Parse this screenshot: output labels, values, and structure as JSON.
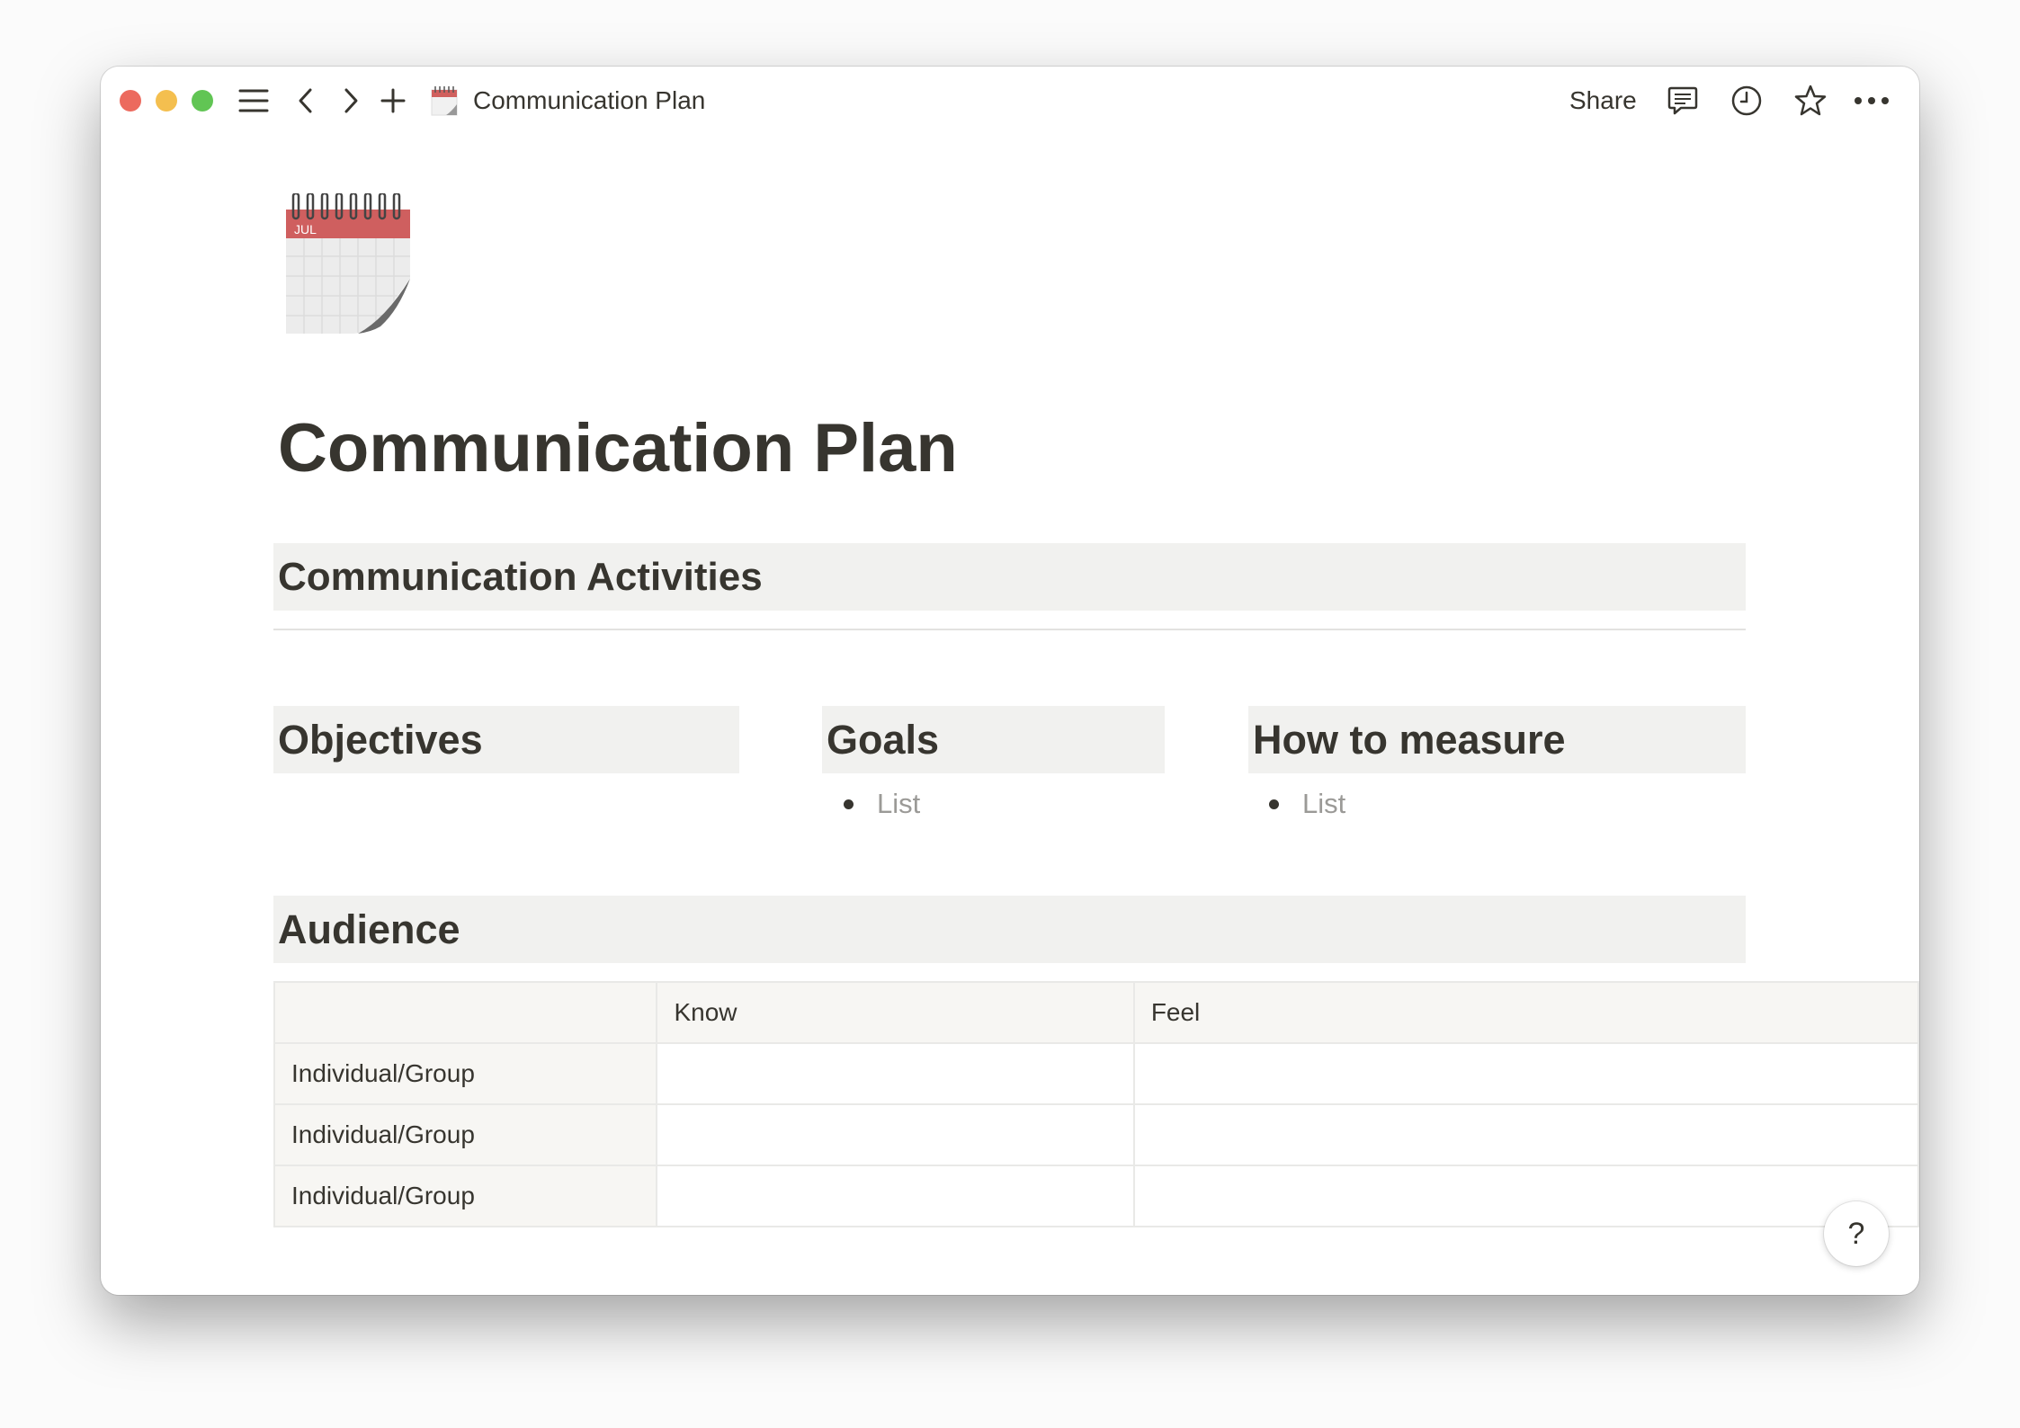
{
  "window": {
    "traffic_lights": {
      "close": "#ec6a5e",
      "minimize": "#f4bf4f",
      "zoom": "#61c554"
    },
    "toolbar": {
      "menu_icon": "hamburger-icon",
      "back_icon": "chevron-left-icon",
      "forward_icon": "chevron-right-icon",
      "new_icon": "plus-icon",
      "page_icon": "spiral-calendar-icon",
      "title": "Communication Plan",
      "share_label": "Share",
      "comments_icon": "comment-icon",
      "history_icon": "clock-icon",
      "favorite_icon": "star-icon",
      "more_icon": "more-dots-icon"
    }
  },
  "page": {
    "icon": "spiral-calendar-icon",
    "icon_month": "JUL",
    "title": "Communication Plan",
    "section_activities": "Communication Activities",
    "columns": [
      {
        "heading": "Objectives",
        "items": []
      },
      {
        "heading": "Goals",
        "items": [
          "List"
        ]
      },
      {
        "heading": "How to measure",
        "items": [
          "List"
        ]
      }
    ],
    "section_audience": "Audience",
    "table": {
      "headers": [
        "",
        "Know",
        "Feel"
      ],
      "rows": [
        [
          "Individual/Group",
          "",
          ""
        ],
        [
          "Individual/Group",
          "",
          ""
        ],
        [
          "Individual/Group",
          "",
          ""
        ]
      ]
    }
  },
  "help_label": "?",
  "colors": {
    "heading_bg": "#f1f1ef",
    "text": "#37352f",
    "placeholder": "#9b9a97",
    "table_header_bg": "#f7f6f3"
  }
}
